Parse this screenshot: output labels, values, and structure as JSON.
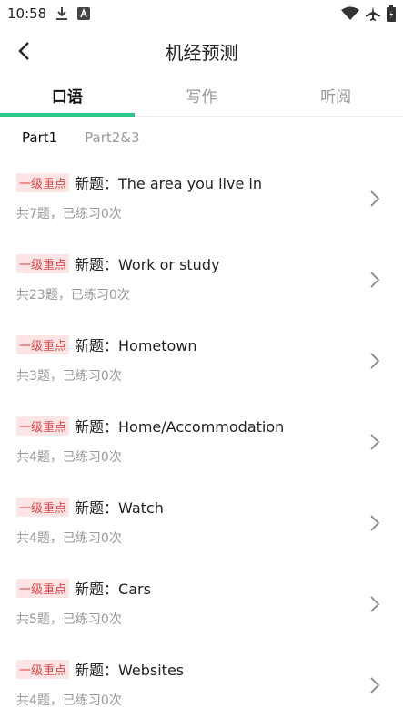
{
  "status": {
    "time": "10:58"
  },
  "header": {
    "title": "机经预测"
  },
  "tabs": [
    {
      "label": "口语",
      "active": true
    },
    {
      "label": "写作",
      "active": false
    },
    {
      "label": "听阅",
      "active": false
    }
  ],
  "subtabs": [
    {
      "label": "Part1",
      "active": true
    },
    {
      "label": "Part2&3",
      "active": false
    }
  ],
  "items": [
    {
      "tag": "一级重点",
      "title": "新题：The area you live in",
      "subtitle": "共7题，已练习0次"
    },
    {
      "tag": "一级重点",
      "title": "新题：Work or study",
      "subtitle": "共23题，已练习0次"
    },
    {
      "tag": "一级重点",
      "title": "新题：Hometown",
      "subtitle": "共3题，已练习0次"
    },
    {
      "tag": "一级重点",
      "title": "新题：Home/Accommodation",
      "subtitle": "共4题，已练习0次"
    },
    {
      "tag": "一级重点",
      "title": "新题：Watch",
      "subtitle": "共4题，已练习0次"
    },
    {
      "tag": "一级重点",
      "title": "新题：Cars",
      "subtitle": "共5题，已练习0次"
    },
    {
      "tag": "一级重点",
      "title": "新题：Websites",
      "subtitle": "共4题，已练习0次"
    }
  ],
  "colors": {
    "accent": "#2ec58a",
    "tag_bg": "#fde5e5",
    "tag_text": "#e04848"
  }
}
